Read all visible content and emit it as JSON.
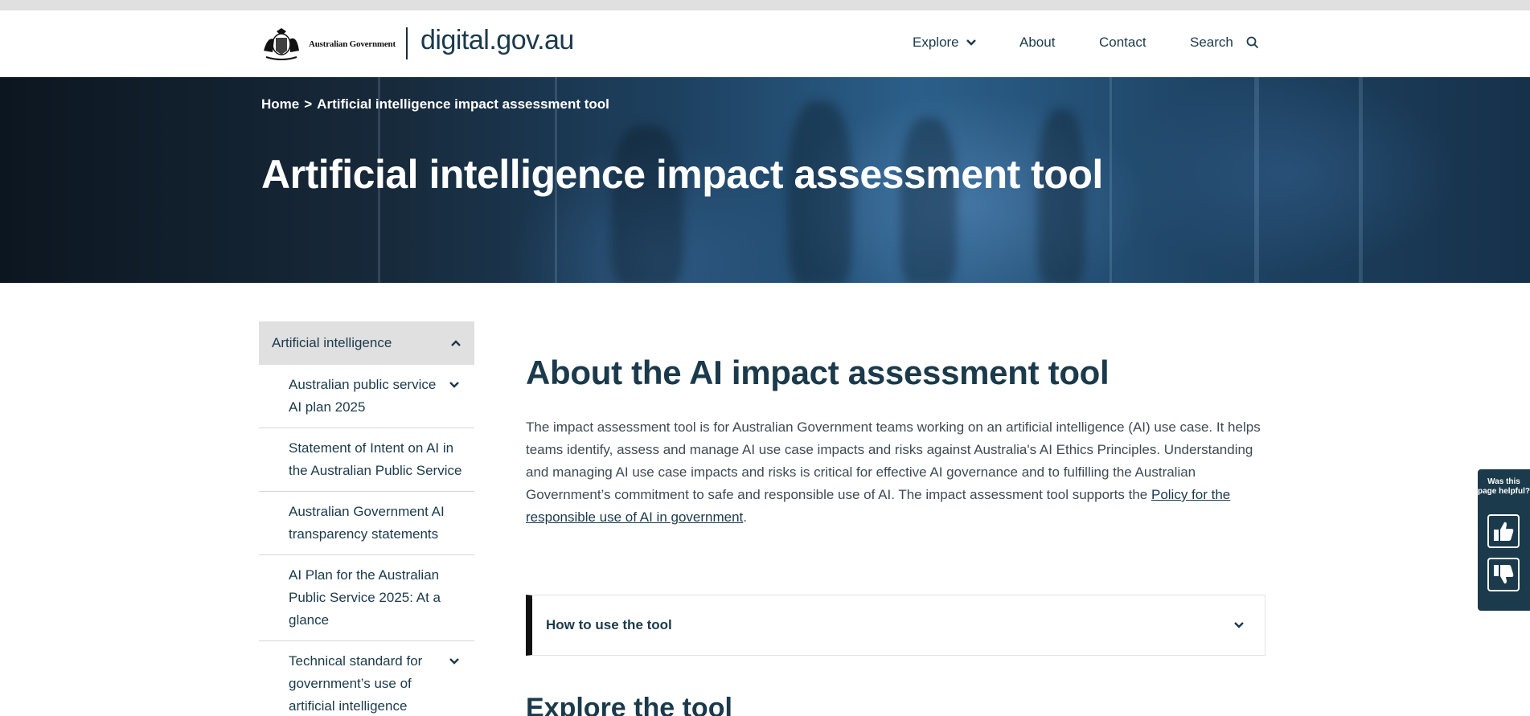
{
  "header": {
    "gov_name": "Australian Government",
    "site_name": "digital.gov.au",
    "nav": {
      "explore": "Explore",
      "about": "About",
      "contact": "Contact",
      "search": "Search"
    }
  },
  "hero": {
    "breadcrumb": {
      "home": "Home",
      "separator": ">",
      "current": "Artificial intelligence impact assessment tool"
    },
    "title": "Artificial intelligence impact assessment tool"
  },
  "sidebar": {
    "heading": "Artificial intelligence",
    "items": [
      {
        "label": "Australian public service AI plan 2025",
        "expandable": true
      },
      {
        "label": "Statement of Intent on AI in the Australian Public Service",
        "expandable": false
      },
      {
        "label": "Australian Government AI transparency statements",
        "expandable": false
      },
      {
        "label": "AI Plan for the Australian Public Service 2025: At a glance",
        "expandable": false
      },
      {
        "label": "Technical standard for government’s use of artificial intelligence",
        "expandable": true
      }
    ]
  },
  "main": {
    "title": "About the AI impact assessment tool",
    "intro_text": "The impact assessment tool is for Australian Government teams working on an artificial intelligence (AI) use case. It helps teams identify, assess and manage AI use case impacts and risks against Australia's AI Ethics Principles. Understanding and managing AI use case impacts and risks is critical for effective AI governance and to fulfilling the Australian Government’s commitment to safe and responsible use of AI. The impact assessment tool supports the ",
    "intro_link": "Policy for the responsible use of AI in government",
    "intro_end": ".",
    "accordion_label": "How to use the tool",
    "explore_heading": "Explore the tool"
  },
  "feedback": {
    "label": "Was this page helpful?"
  },
  "colors": {
    "primary": "#1b3a4b",
    "sidebar_active_bg": "#e0e0e0",
    "accordion_accent": "#111111",
    "body_text": "#3f4a52"
  },
  "icons": {
    "explore_chevron": "chevron-down-icon",
    "search": "search-icon",
    "sidebar_collapse": "chevron-up-icon",
    "thumbs_up": "thumbs-up-icon",
    "thumbs_down": "thumbs-down-icon"
  }
}
